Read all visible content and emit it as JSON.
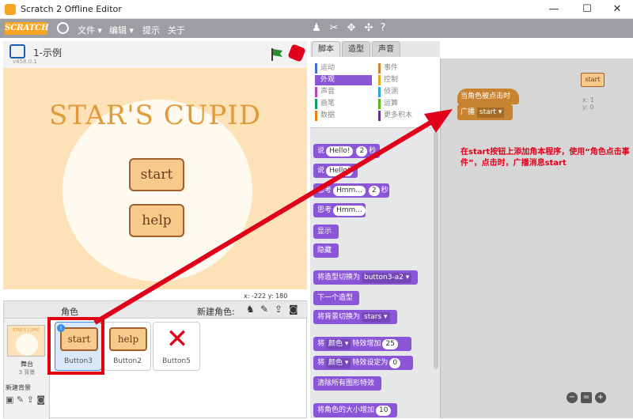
{
  "window": {
    "title": "Scratch 2 Offline Editor",
    "min": "—",
    "max": "☐",
    "close": "✕"
  },
  "menubar": {
    "logo": "SCRATCH",
    "file": "文件 ▾",
    "edit": "编辑 ▾",
    "tips": "提示",
    "about": "关于"
  },
  "toolbar_icons": [
    "duplicate-icon",
    "delete-icon",
    "grow-icon",
    "shrink-icon",
    "help-icon"
  ],
  "stage": {
    "title": "1-示例",
    "version": "v458.0.1",
    "heading": "STAR'S CUPID",
    "start_label": "start",
    "help_label": "help",
    "coords": "x: -222  y: 180"
  },
  "sprites": {
    "header": "角色",
    "new_sprite": "新建角色:",
    "stage_label": "舞台",
    "stage_bg_count": "3 背景",
    "new_backdrop": "新建背景",
    "stage_thumb_text": "STAR'S CUPID",
    "items": [
      {
        "name": "Button3",
        "thumb": "start"
      },
      {
        "name": "Button2",
        "thumb": "help"
      },
      {
        "name": "Button5",
        "thumb": "✕"
      }
    ]
  },
  "tabs": [
    "脚本",
    "造型",
    "声音"
  ],
  "categories": [
    {
      "label": "运动",
      "color": "#4a6cd4"
    },
    {
      "label": "事件",
      "color": "#c88330"
    },
    {
      "label": "外观",
      "color": "#8a55d7"
    },
    {
      "label": "控制",
      "color": "#e1a91a"
    },
    {
      "label": "声音",
      "color": "#bb42c3"
    },
    {
      "label": "侦测",
      "color": "#2ca5e2"
    },
    {
      "label": "画笔",
      "color": "#0e9a6c"
    },
    {
      "label": "运算",
      "color": "#5cb712"
    },
    {
      "label": "数据",
      "color": "#ee7d16"
    },
    {
      "label": "更多积木",
      "color": "#632d99"
    }
  ],
  "blocks": [
    {
      "pre": "说",
      "slot": "Hello!",
      "num": "2",
      "post": "秒"
    },
    {
      "pre": "说",
      "slot": "Hello!",
      "num": "",
      "post": ""
    },
    {
      "pre": "思考",
      "slot": "Hmm...",
      "num": "2",
      "post": "秒"
    },
    {
      "pre": "思考",
      "slot": "Hmm...",
      "num": "",
      "post": ""
    },
    {
      "pre": "显示",
      "slot": "",
      "num": "",
      "post": ""
    },
    {
      "pre": "隐藏",
      "slot": "",
      "num": "",
      "post": ""
    },
    {
      "pre": "将造型切换为",
      "slot": "button3-a2 ▾",
      "num": "",
      "post": ""
    },
    {
      "pre": "下一个造型",
      "slot": "",
      "num": "",
      "post": ""
    },
    {
      "pre": "将背景切换为",
      "slot": "stars ▾",
      "num": "",
      "post": ""
    },
    {
      "pre": "将",
      "slot": "颜色 ▾",
      "num": "25",
      "post": "特效增加"
    },
    {
      "pre": "将",
      "slot": "颜色 ▾",
      "num": "0",
      "post": "特效设定为"
    },
    {
      "pre": "清除所有图形特效",
      "slot": "",
      "num": "",
      "post": ""
    },
    {
      "pre": "将角色的大小增加",
      "slot": "",
      "num": "10",
      "post": ""
    }
  ],
  "script": {
    "hat": "当角色被点击时",
    "broadcast": "广播",
    "message": "start ▾",
    "note": "在start按钮上添加角本程序，使用“角色点击事件”，点击时，广播消息start",
    "sprite_label": "start",
    "x": "x: 1",
    "y": "y: 0"
  },
  "colors": {
    "looks": "#8a55d7",
    "events": "#c88330",
    "annotation": "#e0001b"
  }
}
